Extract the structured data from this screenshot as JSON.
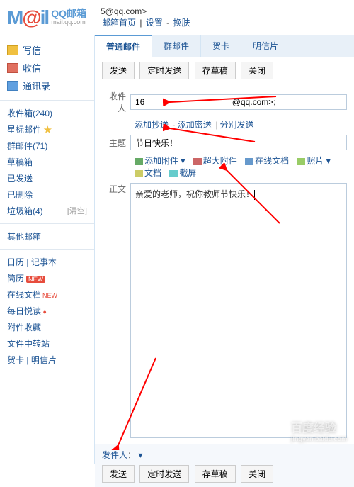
{
  "header": {
    "logo_zh": "QQ邮箱",
    "logo_en": "mail.qq.com",
    "user_email": "5@qq.com>",
    "nav_home": "邮箱首页",
    "nav_settings": "设置",
    "nav_skin": "换肤"
  },
  "sidebar": {
    "compose": "写信",
    "receive": "收信",
    "contacts": "通讯录",
    "folders": {
      "inbox": "收件箱(240)",
      "starred": "星标邮件",
      "group": "群邮件(71)",
      "drafts": "草稿箱",
      "sent": "已发送",
      "deleted": "已删除",
      "trash": "垃圾箱(4)",
      "clear": "[清空]",
      "other": "其他邮箱",
      "calendar": "日历",
      "notes": "记事本",
      "resume": "简历",
      "resume_badge": "NEW",
      "docs": "在线文档",
      "docs_new": "NEW",
      "daily": "每日悦读",
      "attachments": "附件收藏",
      "transfer": "文件中转站",
      "cards": "贺卡",
      "postcards": "明信片"
    }
  },
  "tabs": {
    "normal": "普通邮件",
    "group": "群邮件",
    "card": "贺卡",
    "postcard": "明信片"
  },
  "toolbar": {
    "send": "发送",
    "scheduled": "定时发送",
    "draft": "存草稿",
    "close": "关闭"
  },
  "compose": {
    "to_label": "收件人",
    "to_value": "16                                     @qq.com>;",
    "add_cc": "添加抄送",
    "add_bcc": "添加密送",
    "split_send": "分别发送",
    "subject_label": "主题",
    "subject_value": "节日快乐！",
    "attach": "添加附件",
    "big_attach": "超大附件",
    "online_doc": "在线文档",
    "photo": "照片",
    "doc": "文档",
    "screenshot": "截屏",
    "body_label": "正文",
    "body_text": "亲爱的老师，祝你教师节快乐！"
  },
  "bottom": {
    "sender_label": "发件人",
    "sender_value": "                                          ▾"
  },
  "annotations": {
    "arrow_color": "#ff0000"
  },
  "watermark": {
    "main": "百度经验",
    "sub": "jingyan.baidu.com"
  }
}
